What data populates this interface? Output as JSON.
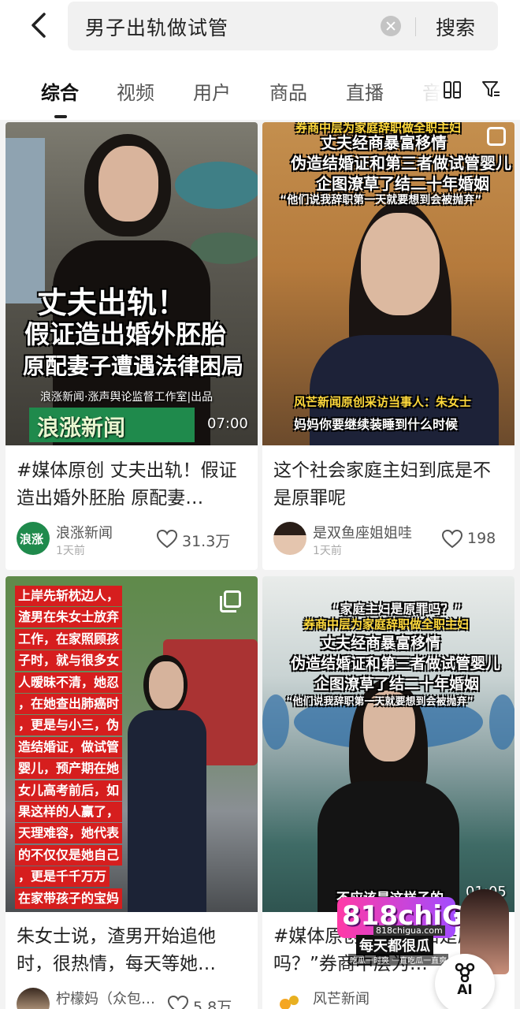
{
  "search": {
    "query": "男子出轨做试管",
    "button": "搜索"
  },
  "tabs": [
    "综合",
    "视频",
    "用户",
    "商品",
    "直播",
    "音"
  ],
  "cards": [
    {
      "overlay_lines": [
        "丈夫出轨！",
        "假证造出婚外胚胎",
        "原配妻子遭遇法律困局"
      ],
      "overlay_credit": "浪涨新闻·涨声舆论监督工作室|出品",
      "overlay_logo": "浪涨新闻",
      "duration": "07:00",
      "title": "#媒体原创 丈夫出轨！假证造出婚外胚胎 原配妻…",
      "author": "浪涨新闻",
      "avatar_text": "浪涨",
      "time": "1天前",
      "likes": "31.3万"
    },
    {
      "overlay_top": [
        "券商中层为家庭辞职做全职主妇",
        "丈夫经商暴富移情",
        "伪造结婚证和第三者做试管婴儿",
        "企图潦草了结二十年婚姻",
        "“他们说我辞职第一天就要想到会被抛弃”"
      ],
      "overlay_interview": "风芒新闻原创采访当事人：朱女士",
      "overlay_sub": "妈妈你要继续装睡到什么时候",
      "title": "这个社会家庭主妇到底是不是原罪呢",
      "author": "是双鱼座姐姐哇",
      "time": "1天前",
      "likes": "198"
    },
    {
      "overlay_lines": [
        "上岸先斩枕边人，",
        "渣男在朱女士放弃",
        "工作，在家照顾孩",
        "子时，就与很多女",
        "人暧昧不清，她忍",
        "，在她查出肺癌时",
        "，更是与小三，伪",
        "造结婚证，做试管",
        "婴儿，预产期在她",
        "女儿高考前后，如",
        "果这样的人赢了，",
        "天理难容，她代表",
        "的不仅仅是她自己",
        "，更是千千万万",
        "在家带孩子的宝妈"
      ],
      "title": "朱女士说，渣男开始追他时，很热情，每天等她…",
      "author": "柠檬妈（众包…",
      "likes": "5.8万"
    },
    {
      "overlay_top": [
        "“家庭主妇是原罪吗？”",
        "券商中层为家庭辞职做全职主妇",
        "丈夫经商暴富移情",
        "伪造结婚证和第三者做试管婴儿",
        "企图潦草了结二十年婚姻",
        "“他们说我辞职第一天就要想到会被抛弃”"
      ],
      "overlay_sub": "不应该是这样子的",
      "duration": "01:05",
      "title": "#媒体原创 家庭主妇是原罪吗？”券商中层为…",
      "author": "风芒新闻"
    }
  ],
  "watermark": {
    "brand": "818chiGUA",
    "slogan": "每天都很瓜",
    "sub": "吃瓜一时爽 一直吃瓜一直爽",
    "site": "818chigua.com"
  },
  "ai_button": "AI",
  "colors": {
    "accent_red": "#d61e1e",
    "logo_green": "#1f8a4c",
    "overlay_yellow": "#ffd93b"
  }
}
